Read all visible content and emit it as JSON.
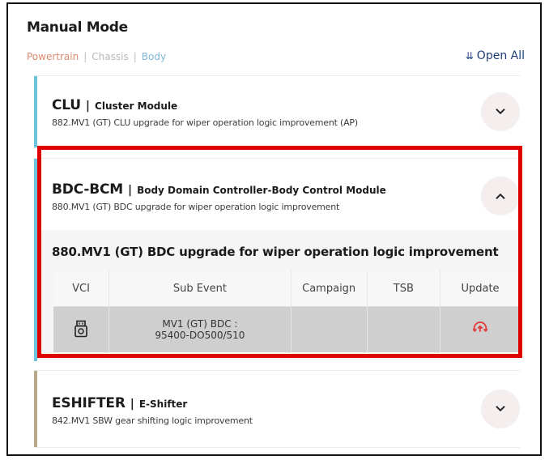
{
  "header": {
    "title": "Manual Mode",
    "open_all": "Open All"
  },
  "filters": {
    "powertrain": "Powertrain",
    "chassis": "Chassis",
    "body": "Body",
    "separator": "|"
  },
  "cards": {
    "clu": {
      "code": "CLU",
      "pipe": "|",
      "name": "Cluster Module",
      "desc": "882.MV1 (GT) CLU upgrade for wiper operation logic improvement (AP)",
      "expanded": false
    },
    "bdc": {
      "code": "BDC-BCM",
      "pipe": "|",
      "name": "Body Domain Controller-Body Control Module",
      "desc": "880.MV1 (GT) BDC upgrade for wiper operation logic improvement",
      "expanded": true,
      "detail_title": "880.MV1 (GT) BDC upgrade for wiper operation logic improvement",
      "table": {
        "headers": [
          "VCI",
          "Sub Event",
          "Campaign",
          "TSB",
          "Update"
        ],
        "row": {
          "sub_event_line1": "MV1 (GT) BDC :",
          "sub_event_line2": "95400-DO500/510",
          "campaign": "",
          "tsb": ""
        }
      }
    },
    "esh": {
      "code": "ESHIFTER",
      "pipe": "|",
      "name": "E-Shifter",
      "desc": "842.MV1 SBW gear shifting logic improvement",
      "expanded": false
    }
  },
  "colors": {
    "highlight": "#e00000",
    "stripe_blue": "#6fc2de",
    "stripe_tan": "#b7a98a",
    "update_icon": "#e23b3b",
    "link": "#1e3f7a"
  },
  "icons": {
    "vci": "usb-device-icon",
    "update": "update-icon",
    "open_all": "double-chevron-down-icon"
  }
}
